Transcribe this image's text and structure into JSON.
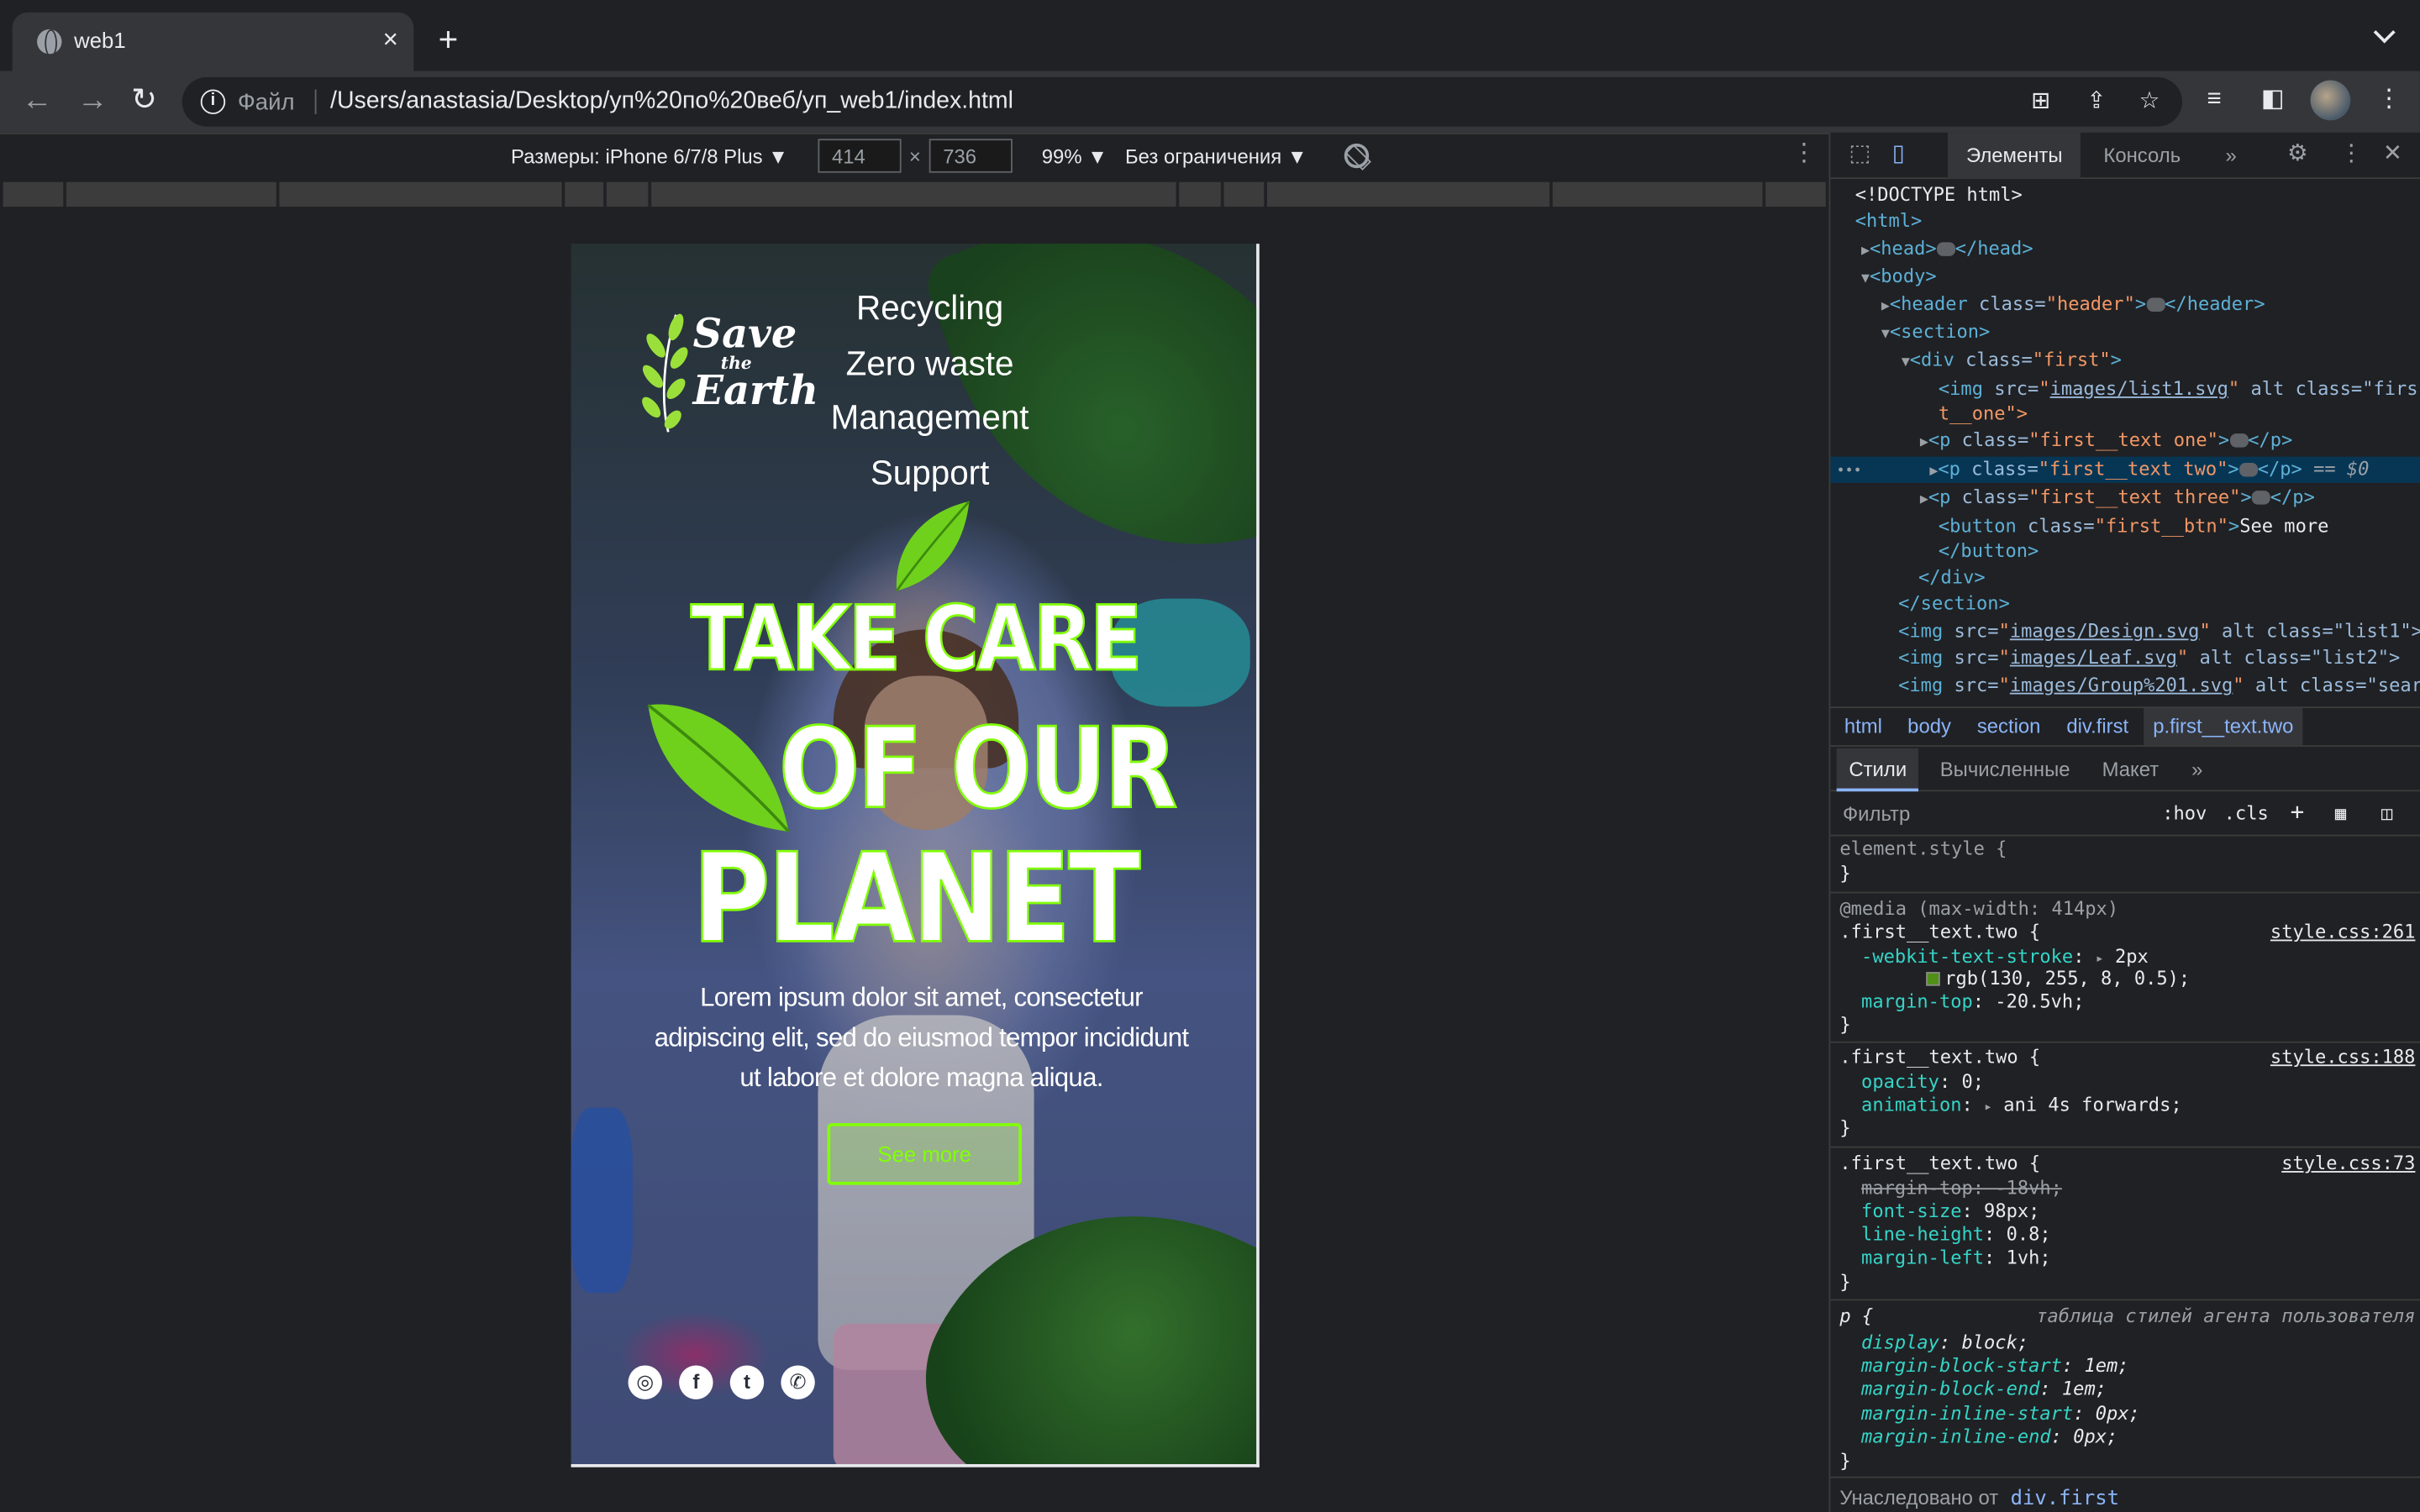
{
  "browser": {
    "tab_title": "web1",
    "tab_close": "×",
    "new_tab": "+",
    "back": "←",
    "forward": "→",
    "reload": "↻",
    "info": "i",
    "file_label": "Файл",
    "url": "/Users/anastasia/Desktop/уп%20по%20веб/уп_web1/index.html",
    "menu": "⋮"
  },
  "device_toolbar": {
    "dimensions_label": "Размеры: iPhone 6/7/8 Plus ▼",
    "width": "414",
    "height": "736",
    "x": "×",
    "zoom": "99% ▼",
    "throttle": "Без ограничения ▼",
    "more": "⋮"
  },
  "page": {
    "logo": {
      "line1": "Save",
      "line2": "the",
      "line3": "Earth"
    },
    "nav": [
      "Recycling",
      "Zero waste",
      "Management",
      "Support"
    ],
    "headline": [
      "TAKE CARE",
      "OF OUR",
      "PLANET"
    ],
    "body": "Lorem ipsum dolor sit amet, consectetur adipiscing elit, sed do eiusmod tempor incididunt ut labore et dolore magna aliqua.",
    "button": "See more",
    "socials": [
      "instagram-icon",
      "facebook-icon",
      "twitter-icon",
      "whatsapp-icon"
    ],
    "social_glyphs": [
      "◎",
      "f",
      "t",
      "✆"
    ],
    "accent": "#82ff08"
  },
  "devtools": {
    "tabs": {
      "elements": "Элементы",
      "console": "Консоль",
      "more": "»"
    },
    "dom": {
      "doctype": "<!DOCTYPE html>",
      "html": "<html>",
      "head_open": "<head>",
      "head_close": "</head>",
      "body": "<body>",
      "header_open": "<header ",
      "header_attr": "class=",
      "header_val": "\"header\"",
      "header_end": ">",
      "header_close": "</header>",
      "section": "<section>",
      "div_open": "<div ",
      "div_val": "\"first\"",
      "img_open": "<img ",
      "img_src": "src=",
      "img1_link": "images/list1.svg",
      "img1_rest": " alt class=\"firs",
      "img1_wrap": "t__one\">",
      "p_open": "<p ",
      "p1_val": "\"first__text one\"",
      "p2_val": "\"first__text two\"",
      "p3_val": "\"first__text three\"",
      "p_close": "</p>",
      "sel_marker": " == $0",
      "button_open": "<button ",
      "button_val": "\"first__btn\"",
      "button_text": "See more",
      "button_close": "</button>",
      "div_close": "</div>",
      "section_close": "</section>",
      "img2_link": "images/Design.svg",
      "img2_rest": " alt class=\"list1\">",
      "img3_link": "images/Leaf.svg",
      "img3_rest": " alt class=\"list2\">",
      "img4_link": "images/Group%201.svg",
      "img4_rest": " alt class=\"sear"
    },
    "breadcrumbs": [
      "html",
      "body",
      "section",
      "div.first",
      "p.first__text.two"
    ],
    "style_tabs": [
      "Стили",
      "Вычисленные",
      "Макет",
      "»"
    ],
    "filter_placeholder": "Фильтр",
    "filter_buttons": [
      ":hov",
      ".cls",
      "+"
    ],
    "rules": {
      "element_style": "element.style {",
      "close": "}",
      "media": "@media (max-width: 414px)",
      "r1_selector": ".first__text.two {",
      "r1_src": "style.css:261",
      "r1_p1": "-webkit-text-stroke",
      "r1_v1": "2px",
      "r1_v1b": "rgb(130, 255, 8, 0.5);",
      "r1_p2": "margin-top",
      "r1_v2": "-20.5vh;",
      "r2_selector": ".first__text.two {",
      "r2_src": "style.css:188",
      "r2_p1": "opacity",
      "r2_v1": "0;",
      "r2_p2": "animation",
      "r2_v2": "ani 4s forwards;",
      "r3_selector": ".first__text.two {",
      "r3_src": "style.css:73",
      "r3_struck": "margin-top: -18vh;",
      "r3_p1": "font-size",
      "r3_v1": "98px;",
      "r3_p2": "line-height",
      "r3_v2": "0.8;",
      "r3_p3": "margin-left",
      "r3_v3": "1vh;",
      "ua_selector": "p {",
      "ua_label": "таблица стилей агента пользователя",
      "ua_props": [
        {
          "p": "display",
          "v": "block;"
        },
        {
          "p": "margin-block-start",
          "v": "1em;"
        },
        {
          "p": "margin-block-end",
          "v": "1em;"
        },
        {
          "p": "margin-inline-start",
          "v": "0px;"
        },
        {
          "p": "margin-inline-end",
          "v": "0px;"
        }
      ],
      "inherited_label": "Унаследовано от",
      "inherited_from": "div.first"
    }
  }
}
